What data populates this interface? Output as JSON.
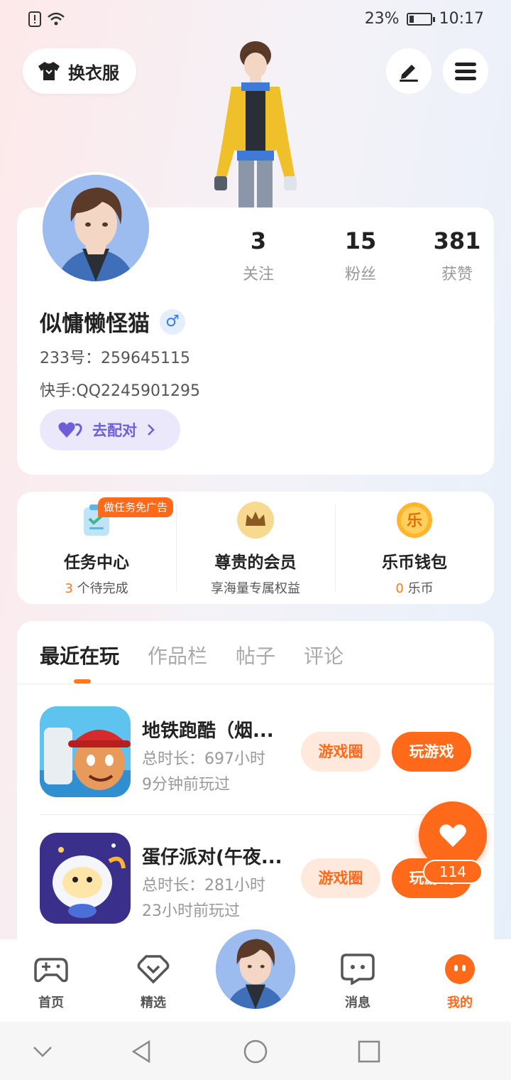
{
  "status_bar": {
    "battery": "23%",
    "battery_level": 0.23,
    "time": "10:17"
  },
  "top": {
    "outfit_label": "换衣服"
  },
  "profile": {
    "stats": [
      {
        "value": "3",
        "label": "关注"
      },
      {
        "value": "15",
        "label": "粉丝"
      },
      {
        "value": "381",
        "label": "获赞"
      }
    ],
    "name": "似慵懒怪猫",
    "gender_symbol": "♂",
    "id_line": "233号：259645115",
    "kuaishou_line": "快手:QQ2245901295",
    "match_label": "去配对"
  },
  "services": [
    {
      "title": "任务中心",
      "sub_highlight": "3",
      "sub_text": " 个待完成",
      "tag": "做任务免广告"
    },
    {
      "title": "尊贵的会员",
      "sub_highlight": "",
      "sub_text": "享海量专属权益"
    },
    {
      "title": "乐币钱包",
      "sub_highlight": "0",
      "sub_text": " 乐币",
      "coin_char": "乐"
    }
  ],
  "tabs": [
    "最近在玩",
    "作品栏",
    "帖子",
    "评论"
  ],
  "games": [
    {
      "name": "地铁跑酷（烟...",
      "duration": "总时长：697小时",
      "last_played": "9分钟前玩过",
      "circle_label": "游戏圈",
      "play_label": "玩游戏"
    },
    {
      "name": "蛋仔派对(午夜...",
      "duration": "总时长：281小时",
      "last_played": "23小时前玩过",
      "circle_label": "游戏圈",
      "play_label": "玩游戏"
    }
  ],
  "like_count": "114",
  "bottom_nav": [
    {
      "label": "首页"
    },
    {
      "label": "精选"
    },
    {
      "label": "消息"
    },
    {
      "label": "我的"
    }
  ],
  "colors": {
    "accent": "#ff6a1a",
    "purple": "#6d5fd8",
    "gender_blue": "#3d7be6"
  }
}
